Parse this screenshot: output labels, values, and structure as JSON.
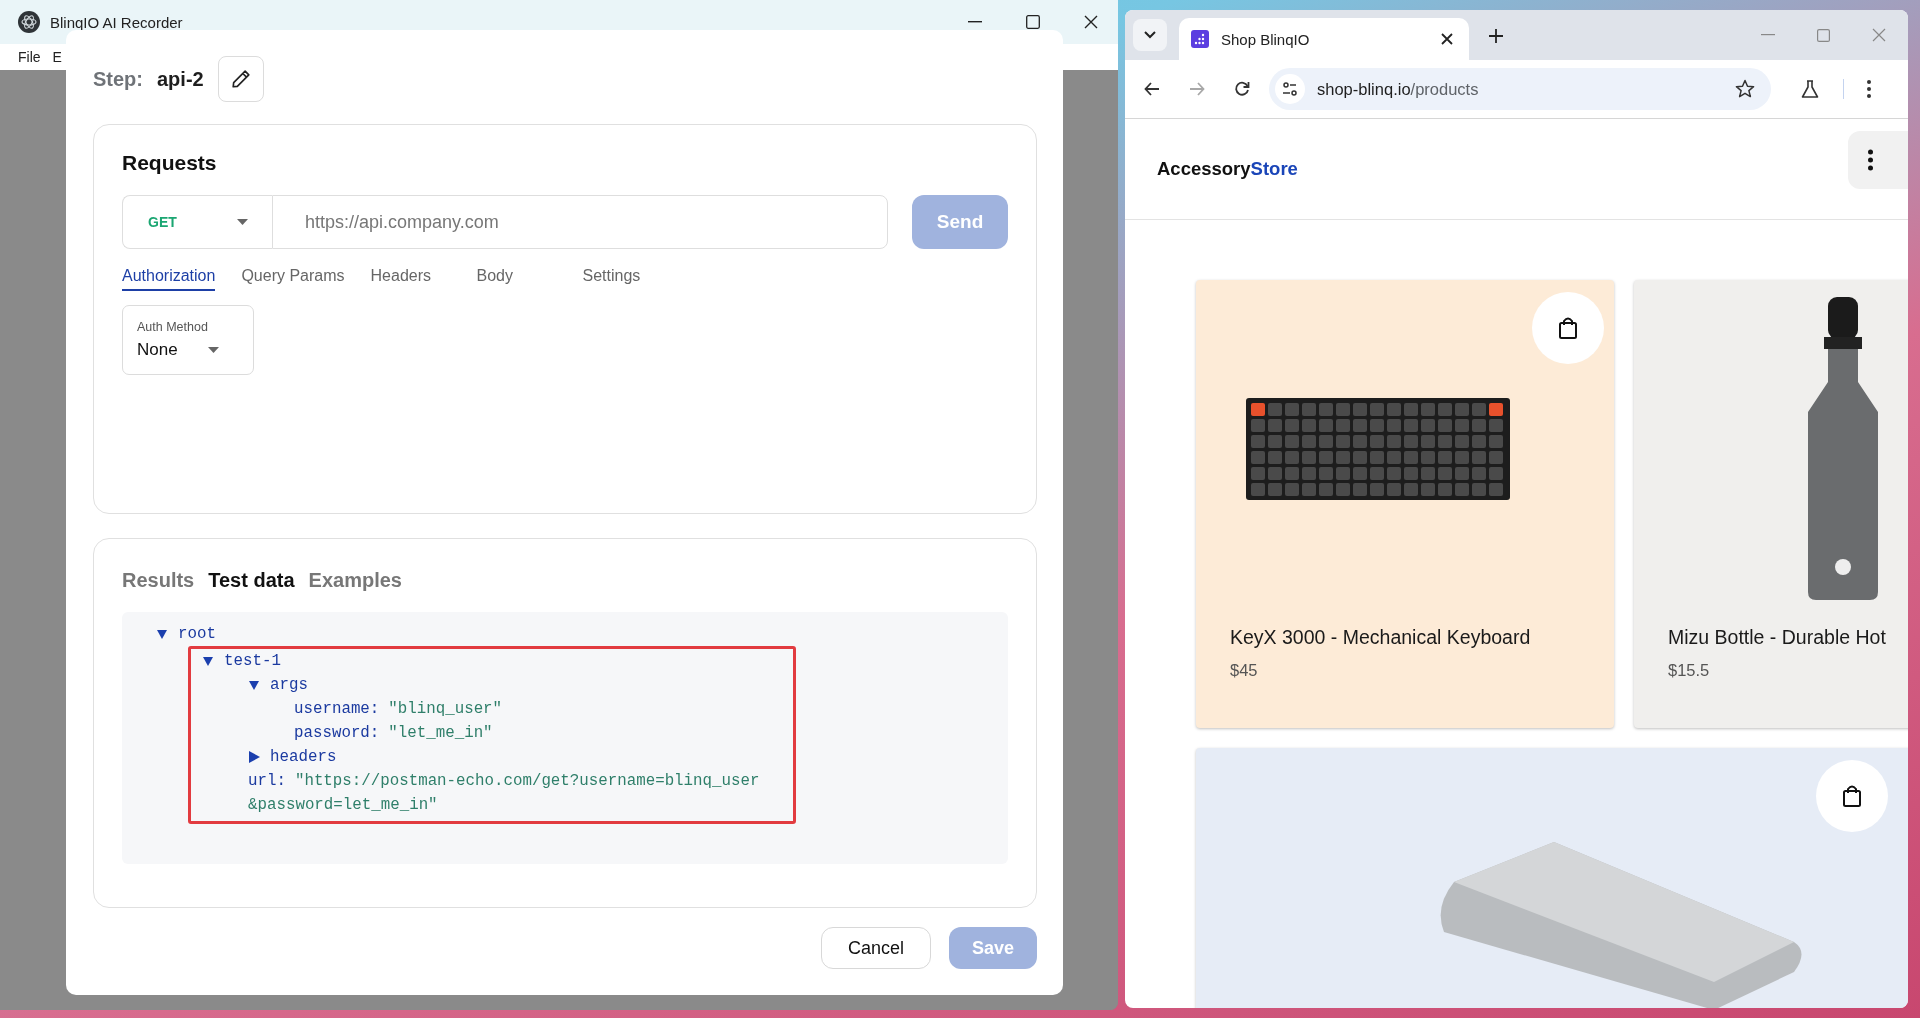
{
  "app_window": {
    "title": "BlinqIO AI Recorder",
    "menu": [
      "File",
      "E"
    ]
  },
  "modal": {
    "step": {
      "label": "Step:",
      "name": "api-2"
    },
    "requests": {
      "title": "Requests",
      "method": "GET",
      "url_placeholder": "https://api.company.com",
      "send": {
        "label": "Send",
        "disabled": true
      },
      "tabs": [
        {
          "label": "Authorization",
          "selected": true
        },
        {
          "label": "Query Params",
          "selected": false
        },
        {
          "label": "Headers",
          "selected": false
        },
        {
          "label": "Body",
          "selected": false
        },
        {
          "label": "Settings",
          "selected": false
        }
      ],
      "auth_method": {
        "label": "Auth Method",
        "value": "None"
      }
    },
    "output": {
      "tabs": [
        {
          "label": "Results",
          "selected": false
        },
        {
          "label": "Test data",
          "selected": true
        },
        {
          "label": "Examples",
          "selected": false
        }
      ],
      "tree": {
        "kind": "object",
        "key": "root",
        "expanded": true,
        "children": [
          {
            "kind": "object",
            "key": "test-1",
            "expanded": true,
            "highlighted": true,
            "children": [
              {
                "kind": "object",
                "key": "args",
                "expanded": true,
                "children": [
                  {
                    "kind": "value",
                    "key": "username:",
                    "value": "\"blinq_user\""
                  },
                  {
                    "kind": "value",
                    "key": "password:",
                    "value": "\"let_me_in\""
                  }
                ]
              },
              {
                "kind": "object",
                "key": "headers",
                "expanded": false
              },
              {
                "kind": "value",
                "key": "url:",
                "value": "\"https://postman-echo.com/get?username=blinq_user&password=let_me_in\""
              }
            ]
          }
        ]
      }
    },
    "buttons": [
      {
        "label": "Cancel",
        "kind": "secondary",
        "disabled": false
      },
      {
        "label": "Save",
        "kind": "primary",
        "disabled": true
      }
    ]
  },
  "browser": {
    "tab": {
      "title": "Shop BlinqIO"
    },
    "forward": {
      "disabled": true
    },
    "address": {
      "host": "shop-blinq.io",
      "path": "/products"
    },
    "store": {
      "brand": "Accessory",
      "brand_accent": "Store"
    },
    "products": [
      {
        "kind": "keyboard",
        "name": "KeyX 3000 - Mechanical Keyboard",
        "price": "$45",
        "color": "#fdebd7",
        "bag_button": true
      },
      {
        "kind": "bottle",
        "name": "Mizu Bottle - Durable Hot",
        "price": "$15.5",
        "color": "#f0efed"
      },
      {
        "kind": "powerbank",
        "color": "#e6ecf6",
        "bag_button": true,
        "wide": true
      }
    ]
  }
}
